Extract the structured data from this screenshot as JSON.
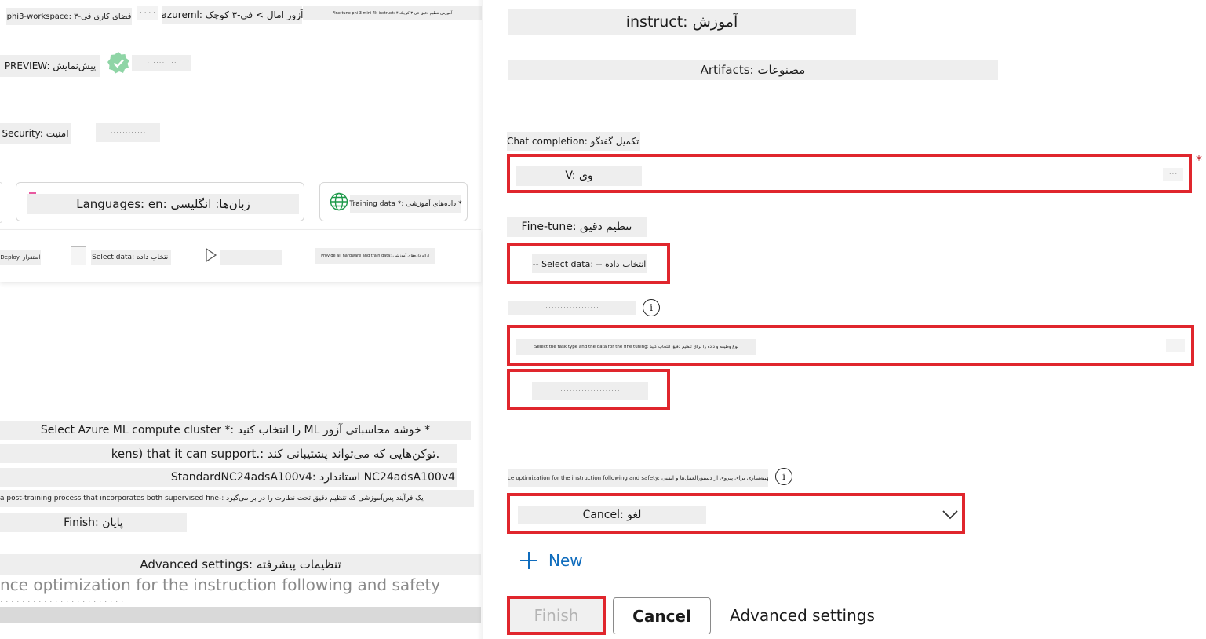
{
  "left": {
    "breadcrumb": {
      "workspace": "phi3-workspace: فضای کاری فی-۳",
      "ellipsis": "· · · ·",
      "model": "azureml: آزور امال > فی-۳ کوچک",
      "job": "Fine tune phi 3 mini 4k instruct: آموزش تنظیم دقیق فی ۳ کوچک ۴"
    },
    "preview_label": "PREVIEW: پیش‌نمایش",
    "verified_text": "· · · · · · · · · ·",
    "security_label": "Security: امنیت",
    "security_value": "· · · · · · · · · · · ·",
    "languages_label": "Languages: en: زبان‌ها: انگلیسی",
    "training_data_label": "Training data *: داده‌های آموزشی *",
    "steps": {
      "deploy": "Deploy: استقرار",
      "select_data": "Select data: انتخاب داده",
      "step3": "· · · · · · · · · · · · · ·",
      "step4": "Provide all hardware and train data: ارائه داده‌های آموزشی"
    },
    "compute_cluster": "Select Azure ML compute cluster *: را انتخاب کنید ML خوشه محاسباتی آزور *",
    "tokens": "kens) that it can support.: توکن‌هایی که می‌تواند پشتیبانی کند.",
    "standard": "StandardNC24adsA100v4: استاندارد NC24adsA100v4",
    "post_training": "a post-training process that incorporates both supervised fine-: یک فرآیند پس‌آموزشی که تنظیم دقیق تحت نظارت را در بر می‌گیرد",
    "finish": "Finish: پایان",
    "advanced_settings": "Advanced settings: تنظیمات پیشرفته",
    "optimization_text": "nce optimization for the instruction following and safety",
    "truncated_text": "· · · · · · · · · · · · · · · · · · · · · · ·"
  },
  "right": {
    "title": "instruct: آموزش",
    "artifacts": "Artifacts: مصنوعات",
    "chat_completion": "Chat completion: تکمیل گفتگو",
    "required_mark": "*",
    "version_value": "V: وی",
    "version_suffix": "· · ·",
    "fine_tune": "Fine-tune: تنظیم دقیق",
    "select_data": "-- Select data: -- انتخاب داده",
    "field_label": "· · · · · · · · · · · · · · · · · ·",
    "info_icon": "i",
    "long_field_value": "Select the task type and the data for the fine tuning: نوع وظیفه و داده را برای تنظیم دقیق انتخاب کنید",
    "long_field_suffix": "· ·",
    "small_field_value": "· · · · · · · · · · · · · · · · · · · ·",
    "optimization_label": "ce optimization for the instruction following and safety: بهینه‌سازی برای پیروی از دستورالعمل‌ها و ایمنی",
    "info_icon2": "i",
    "cancel_select": "Cancel: لغو",
    "new_label": "New",
    "finish_button": "Finish",
    "cancel_button": "Cancel",
    "advanced_link": "Advanced settings"
  },
  "colors": {
    "accent": "#0f6cbd",
    "highlight_red": "#e0262d",
    "verified_green": "#8fd5a6"
  }
}
